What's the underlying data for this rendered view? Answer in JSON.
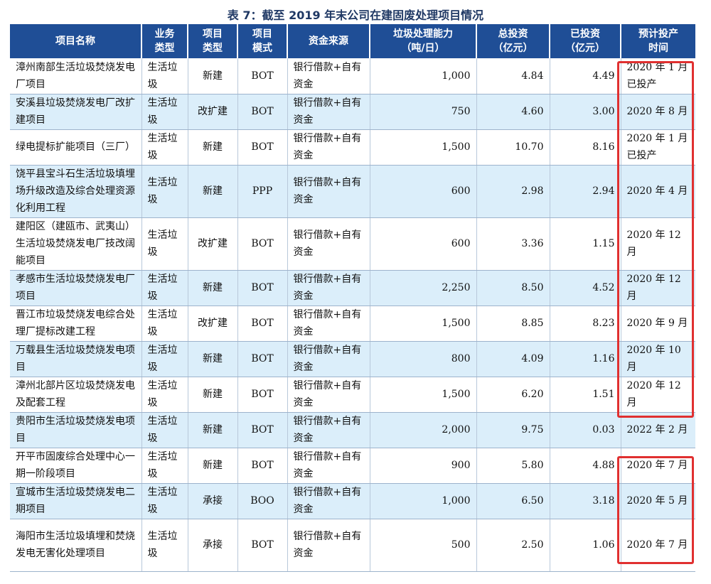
{
  "title": "表 7：截至 2019 年末公司在建固废处理项目情况",
  "headers": {
    "name": "项目名称",
    "biz_type": "业务\n类型",
    "proj_type": "项目\n类型",
    "mode": "项目\n模式",
    "funding": "资金来源",
    "capacity": "垃圾处理能力\n（吨/日）",
    "total": "总投资\n（亿元）",
    "invested": "已投资\n（亿元）",
    "expected": "预计投产\n时间"
  },
  "rows": [
    {
      "name": "漳州南部生活垃圾焚烧发电厂项目",
      "biz_type": "生活垃圾",
      "proj_type": "新建",
      "mode": "BOT",
      "funding": "银行借款+自有资金",
      "capacity": "1,000",
      "total": "4.84",
      "invested": "4.49",
      "expected": "2020 年 1 月\n已投产"
    },
    {
      "name": "安溪县垃圾焚烧发电厂改扩建项目",
      "biz_type": "生活垃圾",
      "proj_type": "改扩建",
      "mode": "BOT",
      "funding": "银行借款+自有资金",
      "capacity": "750",
      "total": "4.60",
      "invested": "3.00",
      "expected": "2020 年 8 月"
    },
    {
      "name": "绿电提标扩能项目（三厂）",
      "biz_type": "生活垃圾",
      "proj_type": "新建",
      "mode": "BOT",
      "funding": "银行借款+自有资金",
      "capacity": "1,500",
      "total": "10.70",
      "invested": "8.16",
      "expected": "2020 年 1 月\n已投产"
    },
    {
      "name": "饶平县宝斗石生活垃圾填埋场升级改造及综合处理资源化利用工程",
      "biz_type": "生活垃圾",
      "proj_type": "新建",
      "mode": "PPP",
      "funding": "银行借款+自有资金",
      "capacity": "600",
      "total": "2.98",
      "invested": "2.94",
      "expected": "2020 年 4 月"
    },
    {
      "name": "建阳区（建瓯市、武夷山）生活垃圾焚烧发电厂技改阔能项目",
      "biz_type": "生活垃圾",
      "proj_type": "改扩建",
      "mode": "BOT",
      "funding": "银行借款+自有资金",
      "capacity": "600",
      "total": "3.36",
      "invested": "1.15",
      "expected": "2020 年 12 月"
    },
    {
      "name": "孝感市生活垃圾焚烧发电厂项目",
      "biz_type": "生活垃圾",
      "proj_type": "新建",
      "mode": "BOT",
      "funding": "银行借款+自有资金",
      "capacity": "2,250",
      "total": "8.50",
      "invested": "4.52",
      "expected": "2020 年 12 月"
    },
    {
      "name": "晋江市垃圾焚烧发电综合处理厂提标改建工程",
      "biz_type": "生活垃圾",
      "proj_type": "改扩建",
      "mode": "BOT",
      "funding": "银行借款+自有资金",
      "capacity": "1,500",
      "total": "8.85",
      "invested": "8.23",
      "expected": "2020 年 9 月"
    },
    {
      "name": "万载县生活垃圾焚烧发电项目",
      "biz_type": "生活垃圾",
      "proj_type": "新建",
      "mode": "BOT",
      "funding": "银行借款+自有资金",
      "capacity": "800",
      "total": "4.09",
      "invested": "1.16",
      "expected": "2020 年 10 月"
    },
    {
      "name": "漳州北部片区垃圾焚烧发电及配套工程",
      "biz_type": "生活垃圾",
      "proj_type": "新建",
      "mode": "BOT",
      "funding": "银行借款+自有资金",
      "capacity": "1,500",
      "total": "6.20",
      "invested": "1.51",
      "expected": "2020 年 12 月"
    },
    {
      "name": "贵阳市生活垃圾焚烧发电项目",
      "biz_type": "生活垃圾",
      "proj_type": "新建",
      "mode": "BOT",
      "funding": "银行借款+自有资金",
      "capacity": "2,000",
      "total": "9.75",
      "invested": "0.03",
      "expected": "2022 年 2 月"
    },
    {
      "name": "开平市固废综合处理中心一期一阶段项目",
      "biz_type": "生活垃圾",
      "proj_type": "新建",
      "mode": "BOT",
      "funding": "银行借款+自有资金",
      "capacity": "900",
      "total": "5.80",
      "invested": "4.88",
      "expected": "2020 年 7 月"
    },
    {
      "name": "宣城市生活垃圾焚烧发电二期项目",
      "biz_type": "生活垃圾",
      "proj_type": "承接",
      "mode": "BOO",
      "funding": "银行借款+自有资金",
      "capacity": "1,000",
      "total": "6.50",
      "invested": "3.18",
      "expected": "2020 年 5 月"
    },
    {
      "name": "海阳市生活垃圾填埋和焚烧发电无害化处理项目",
      "biz_type": "生活垃圾",
      "proj_type": "承接",
      "mode": "BOT",
      "funding": "银行借款+自有资金",
      "capacity": "500",
      "total": "2.50",
      "invested": "1.06",
      "expected": "2020 年 7 月"
    }
  ],
  "accent_colors": {
    "header": "#1f4e96",
    "row_shade": "#dbeefa",
    "highlight": "#e03030",
    "title": "#1f3864"
  }
}
